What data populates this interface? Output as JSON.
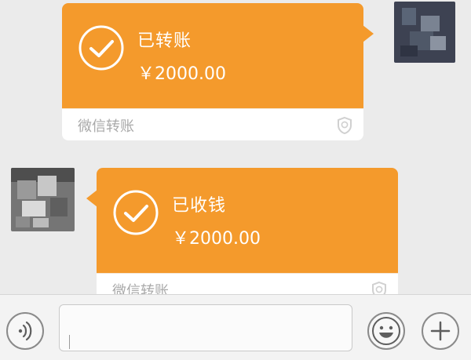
{
  "messages": [
    {
      "status": "已转账",
      "amount": "￥2000.00",
      "footer": "微信转账"
    },
    {
      "status": "已收钱",
      "amount": "￥2000.00",
      "footer": "微信转账"
    }
  ],
  "colors": {
    "bubble_orange": "#f49a2c",
    "footer_white": "#ffffff",
    "chat_bg": "#ebebeb",
    "input_bg": "#f3f3f3",
    "icon_gray": "#8a8a8a"
  },
  "icons": {
    "check": "check-circle-icon",
    "shield": "wechat-pay-shield-icon",
    "voice": "voice-icon",
    "emoji": "emoji-icon",
    "plus": "plus-icon"
  }
}
